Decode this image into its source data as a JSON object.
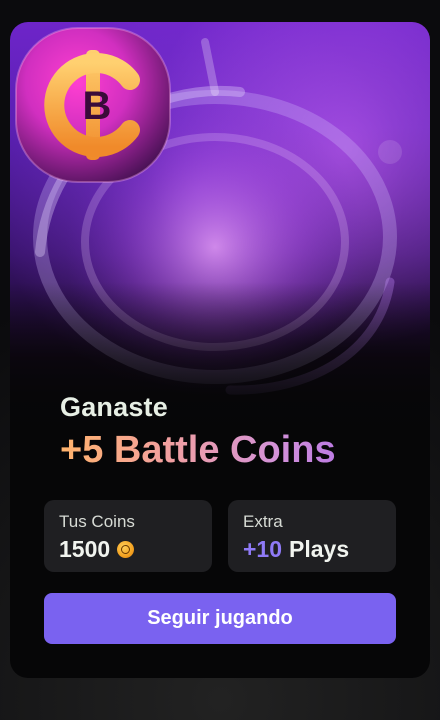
{
  "reward": {
    "kicker": "Ganaste",
    "headline": "+5 Battle Coins"
  },
  "stats": {
    "coins": {
      "label": "Tus Coins",
      "value": "1500",
      "icon": "coin-icon"
    },
    "extra": {
      "label": "Extra",
      "value_accent": "+10",
      "value_suffix": "Plays"
    }
  },
  "actions": {
    "continue_label": "Seguir jugando"
  },
  "colors": {
    "accent": "#7a62f0",
    "hero_top": "#6e25c9",
    "coin_gold": "#f5a33a",
    "headline_start": "#ffb36b",
    "headline_end": "#9d5cf1"
  }
}
